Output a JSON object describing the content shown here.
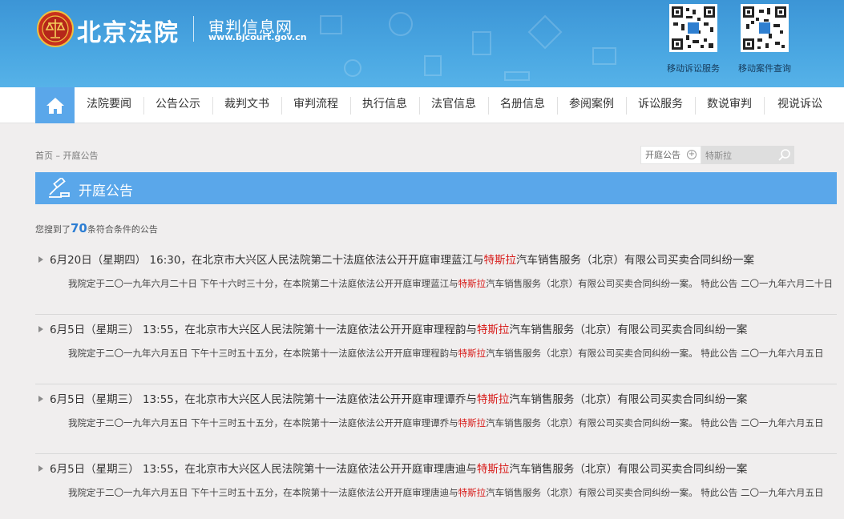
{
  "header": {
    "site_name": "北京法院",
    "subtitle": "审判信息网",
    "url": "www.bjcourt.gov.cn",
    "qr_codes": [
      {
        "label": "移动诉讼服务"
      },
      {
        "label": "移动案件查询"
      }
    ]
  },
  "nav": {
    "home_icon": "home-icon",
    "items": [
      "法院要闻",
      "公告公示",
      "裁判文书",
      "审判流程",
      "执行信息",
      "法官信息",
      "名册信息",
      "参阅案例",
      "诉讼服务",
      "数说审判",
      "视说诉讼"
    ]
  },
  "breadcrumb": "首页 – 开庭公告",
  "search": {
    "scope": "开庭公告",
    "value": "特斯拉"
  },
  "section": {
    "title": "开庭公告",
    "icon": "gavel-icon"
  },
  "result_count": {
    "prefix": "您搜到了",
    "count": "70",
    "suffix": "条符合条件的公告"
  },
  "notices": [
    {
      "headline_pre": "6月20日（星期四） 16:30，在北京市大兴区人民法院第二十法庭依法公开开庭审理蓝江与",
      "keyword": "特斯拉",
      "headline_post": "汽车销售服务（北京）有限公司买卖合同纠纷一案",
      "body_pre": "我院定于二〇一九年六月二十日 下午十六时三十分，在本院第二十法庭依法公开开庭审理蓝江与",
      "body_post": "汽车销售服务（北京）有限公司买卖合同纠纷一案。 特此公告 二〇一九年六月二十日"
    },
    {
      "headline_pre": "6月5日（星期三） 13:55，在北京市大兴区人民法院第十一法庭依法公开开庭审理程韵与",
      "keyword": "特斯拉",
      "headline_post": "汽车销售服务（北京）有限公司买卖合同纠纷一案",
      "body_pre": "我院定于二〇一九年六月五日 下午十三时五十五分，在本院第十一法庭依法公开开庭审理程韵与",
      "body_post": "汽车销售服务（北京）有限公司买卖合同纠纷一案。 特此公告 二〇一九年六月五日"
    },
    {
      "headline_pre": "6月5日（星期三） 13:55，在北京市大兴区人民法院第十一法庭依法公开开庭审理谭乔与",
      "keyword": "特斯拉",
      "headline_post": "汽车销售服务（北京）有限公司买卖合同纠纷一案",
      "body_pre": "我院定于二〇一九年六月五日 下午十三时五十五分，在本院第十一法庭依法公开开庭审理谭乔与",
      "body_post": "汽车销售服务（北京）有限公司买卖合同纠纷一案。 特此公告 二〇一九年六月五日"
    },
    {
      "headline_pre": "6月5日（星期三） 13:55，在北京市大兴区人民法院第十一法庭依法公开开庭审理唐迪与",
      "keyword": "特斯拉",
      "headline_post": "汽车销售服务（北京）有限公司买卖合同纠纷一案",
      "body_pre": "我院定于二〇一九年六月五日 下午十三时五十五分，在本院第十一法庭依法公开开庭审理唐迪与",
      "body_post": "汽车销售服务（北京）有限公司买卖合同纠纷一案。 特此公告 二〇一九年六月五日"
    }
  ],
  "colors": {
    "header_blue": "#4aa7e2",
    "accent_blue": "#5aa7ea",
    "keyword_red": "#d71a18",
    "count_blue": "#2d7ed3"
  }
}
